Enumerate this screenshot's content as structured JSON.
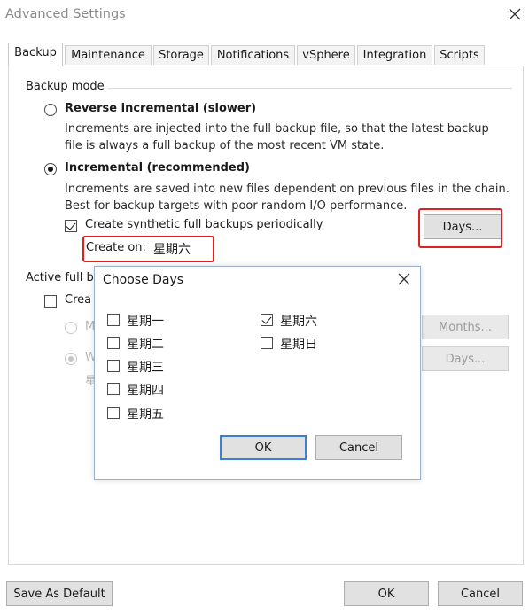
{
  "window": {
    "title": "Advanced Settings"
  },
  "tabs": [
    "Backup",
    "Maintenance",
    "Storage",
    "Notifications",
    "vSphere",
    "Integration",
    "Scripts"
  ],
  "backup_mode": {
    "group_title": "Backup mode",
    "reverse": {
      "label": "Reverse incremental (slower)",
      "desc_line1": "Increments are injected into the full backup file, so that the latest backup",
      "desc_line2": "file is always a full backup of the most recent VM state."
    },
    "incremental": {
      "label": "Incremental (recommended)",
      "desc_line1": "Increments are saved into new files dependent on previous files in the chain.",
      "desc_line2": "Best for backup targets with poor random I/O performance."
    },
    "synthetic_label": "Create synthetic full backups periodically",
    "create_on_label": "Create on:",
    "create_on_value": "星期六",
    "days_button": "Days..."
  },
  "active_full": {
    "group_title_visible": "Active full b",
    "checkbox_label_visible": "Crea",
    "radio1_visible": "M",
    "radio2_visible": "W",
    "extra_visible": "星",
    "months_button": "Months...",
    "days_button": "Days..."
  },
  "choose_days": {
    "title": "Choose Days",
    "days_left": [
      {
        "label": "星期一",
        "checked": false
      },
      {
        "label": "星期二",
        "checked": false
      },
      {
        "label": "星期三",
        "checked": false
      },
      {
        "label": "星期四",
        "checked": false
      },
      {
        "label": "星期五",
        "checked": false
      }
    ],
    "days_right": [
      {
        "label": "星期六",
        "checked": true
      },
      {
        "label": "星期日",
        "checked": false
      }
    ],
    "ok": "OK",
    "cancel": "Cancel"
  },
  "footer": {
    "save_default": "Save As Default",
    "ok": "OK",
    "cancel": "Cancel"
  },
  "colors": {
    "highlight": "#e0201c",
    "focus_border": "#3c7fd8"
  }
}
